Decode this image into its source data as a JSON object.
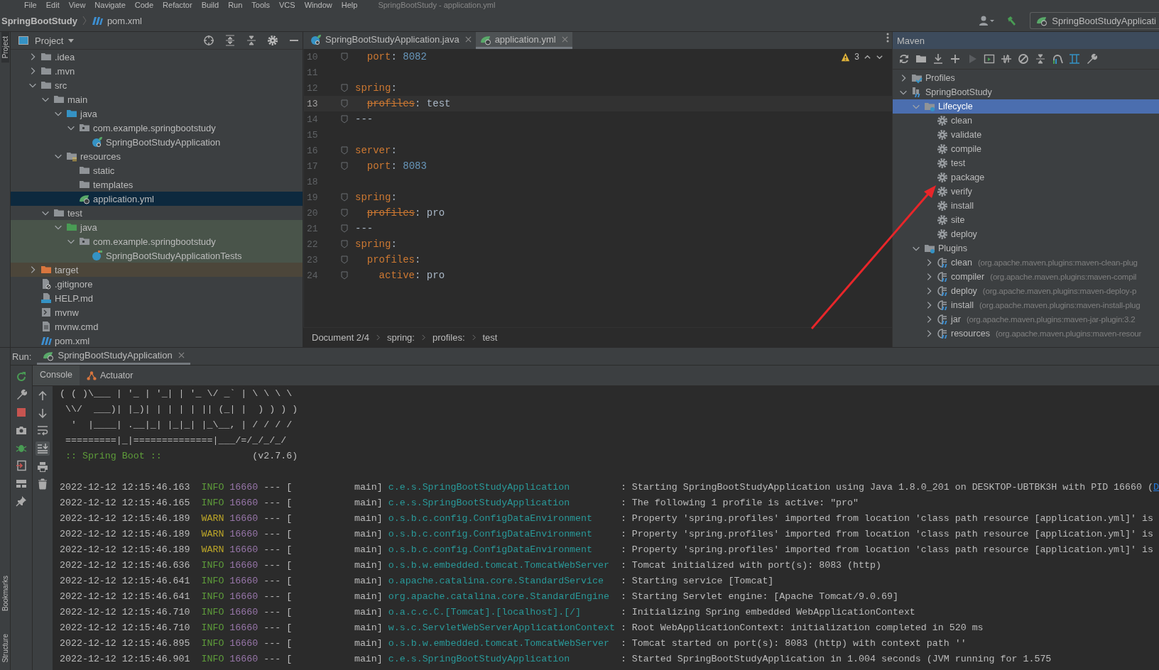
{
  "menu": [
    "File",
    "Edit",
    "View",
    "Navigate",
    "Code",
    "Refactor",
    "Build",
    "Run",
    "Tools",
    "VCS",
    "Window",
    "Help"
  ],
  "window_title": "SpringBootStudy - application.yml",
  "nav": {
    "project": "SpringBootStudy",
    "file": "pom.xml",
    "run_config": "SpringBootStudyApplicati"
  },
  "stripe": {
    "top": "Project",
    "bottom": [
      "Bookmarks",
      "Structure"
    ]
  },
  "project": {
    "title": "Project",
    "tree": [
      {
        "label": ".idea",
        "kind": "folder",
        "expanded": false,
        "selected": false
      },
      {
        "label": ".mvn",
        "kind": "folder",
        "expanded": false,
        "selected": false
      },
      {
        "label": "src",
        "kind": "folder",
        "expanded": true,
        "selected": false,
        "children": [
          {
            "label": "main",
            "kind": "folder",
            "expanded": true,
            "selected": false,
            "children": [
              {
                "label": "java",
                "kind": "source",
                "expanded": true,
                "selected": false,
                "children": [
                  {
                    "label": "com.example.springbootstudy",
                    "kind": "package",
                    "expanded": true,
                    "selected": false,
                    "children": [
                      {
                        "label": "SpringBootStudyApplication",
                        "kind": "class",
                        "selected": false
                      }
                    ]
                  }
                ]
              },
              {
                "label": "resources",
                "kind": "resources",
                "expanded": true,
                "selected": false,
                "children": [
                  {
                    "label": "static",
                    "kind": "folder",
                    "selected": false
                  },
                  {
                    "label": "templates",
                    "kind": "folder",
                    "selected": false
                  },
                  {
                    "label": "application.yml",
                    "kind": "config",
                    "selected": true
                  }
                ]
              }
            ]
          },
          {
            "label": "test",
            "kind": "folder",
            "expanded": true,
            "selected": false,
            "children": [
              {
                "label": "java",
                "kind": "testsource",
                "expanded": true,
                "selected": false,
                "children": [
                  {
                    "label": "com.example.springbootstudy",
                    "kind": "testpackage",
                    "expanded": true,
                    "selected": false,
                    "children": [
                      {
                        "label": "SpringBootStudyApplicationTests",
                        "kind": "testclass",
                        "selected": false
                      }
                    ]
                  }
                ]
              }
            ]
          }
        ]
      },
      {
        "label": "target",
        "kind": "output",
        "expanded": false,
        "selected": false
      },
      {
        "label": ".gitignore",
        "kind": "ignore",
        "selected": false
      },
      {
        "label": "HELP.md",
        "kind": "markdown",
        "selected": false
      },
      {
        "label": "mvnw",
        "kind": "script",
        "selected": false
      },
      {
        "label": "mvnw.cmd",
        "kind": "text",
        "selected": false
      },
      {
        "label": "pom.xml",
        "kind": "pom",
        "selected": false
      }
    ]
  },
  "editor": {
    "tabs": [
      {
        "label": "SpringBootStudyApplication.java",
        "kind": "class",
        "selected": false
      },
      {
        "label": "application.yml",
        "kind": "config",
        "selected": true
      }
    ],
    "warnings": "3",
    "lines": [
      {
        "num": "10",
        "current": false,
        "tokens": [
          {
            "text": "  port",
            "kind": "key"
          },
          {
            "text": ": ",
            "kind": "plain"
          },
          {
            "text": "8082",
            "kind": "number"
          }
        ]
      },
      {
        "num": "11",
        "current": false
      },
      {
        "num": "12",
        "current": false,
        "tokens": [
          {
            "text": "spring",
            "kind": "key"
          },
          {
            "text": ":",
            "kind": "plain"
          }
        ]
      },
      {
        "num": "13",
        "current": true,
        "tokens": [
          {
            "text": "  profiles",
            "kind": "deprecated"
          },
          {
            "text": ": test",
            "kind": "plain"
          }
        ]
      },
      {
        "num": "14",
        "current": false,
        "tokens": [
          {
            "text": "---",
            "kind": "plain"
          }
        ]
      },
      {
        "num": "15",
        "current": false
      },
      {
        "num": "16",
        "current": false,
        "tokens": [
          {
            "text": "server",
            "kind": "key"
          },
          {
            "text": ":",
            "kind": "plain"
          }
        ]
      },
      {
        "num": "17",
        "current": false,
        "tokens": [
          {
            "text": "  port",
            "kind": "key"
          },
          {
            "text": ": ",
            "kind": "plain"
          },
          {
            "text": "8083",
            "kind": "number"
          }
        ]
      },
      {
        "num": "18",
        "current": false
      },
      {
        "num": "19",
        "current": false,
        "tokens": [
          {
            "text": "spring",
            "kind": "key"
          },
          {
            "text": ":",
            "kind": "plain"
          }
        ]
      },
      {
        "num": "20",
        "current": false,
        "tokens": [
          {
            "text": "  profiles",
            "kind": "deprecated"
          },
          {
            "text": ": pro",
            "kind": "plain"
          }
        ]
      },
      {
        "num": "21",
        "current": false,
        "tokens": [
          {
            "text": "---",
            "kind": "plain"
          }
        ]
      },
      {
        "num": "22",
        "current": false,
        "tokens": [
          {
            "text": "spring",
            "kind": "key"
          },
          {
            "text": ":",
            "kind": "plain"
          }
        ]
      },
      {
        "num": "23",
        "current": false,
        "tokens": [
          {
            "text": "  profiles",
            "kind": "key"
          },
          {
            "text": ":",
            "kind": "plain"
          }
        ]
      },
      {
        "num": "24",
        "current": false,
        "tokens": [
          {
            "text": "    active",
            "kind": "key"
          },
          {
            "text": ": pro",
            "kind": "plain"
          }
        ]
      }
    ],
    "breadcrumb": [
      "Document 2/4",
      "spring:",
      "profiles:",
      "test"
    ]
  },
  "maven": {
    "title": "Maven",
    "tree": [
      {
        "label": "Profiles",
        "kind": "profiles",
        "expanded": false,
        "selected": false
      },
      {
        "label": "SpringBootStudy",
        "kind": "project",
        "expanded": true,
        "selected": false,
        "children": [
          {
            "label": "Lifecycle",
            "kind": "group",
            "expanded": true,
            "selected": true,
            "children": [
              {
                "label": "clean",
                "kind": "goal",
                "selected": false
              },
              {
                "label": "validate",
                "kind": "goal",
                "selected": false
              },
              {
                "label": "compile",
                "kind": "goal",
                "selected": false
              },
              {
                "label": "test",
                "kind": "goal",
                "selected": false
              },
              {
                "label": "package",
                "kind": "goal",
                "selected": false
              },
              {
                "label": "verify",
                "kind": "goal",
                "selected": false
              },
              {
                "label": "install",
                "kind": "goal",
                "selected": false
              },
              {
                "label": "site",
                "kind": "goal",
                "selected": false
              },
              {
                "label": "deploy",
                "kind": "goal",
                "selected": false
              }
            ]
          },
          {
            "label": "Plugins",
            "kind": "group",
            "expanded": true,
            "selected": false,
            "children": [
              {
                "label": "clean",
                "detail": "(org.apache.maven.plugins:maven-clean-plug",
                "kind": "plugin",
                "expanded": false,
                "selected": false
              },
              {
                "label": "compiler",
                "detail": "(org.apache.maven.plugins:maven-compil",
                "kind": "plugin",
                "expanded": false,
                "selected": false
              },
              {
                "label": "deploy",
                "detail": "(org.apache.maven.plugins:maven-deploy-p",
                "kind": "plugin",
                "expanded": false,
                "selected": false
              },
              {
                "label": "install",
                "detail": "(org.apache.maven.plugins:maven-install-plug",
                "kind": "plugin",
                "expanded": false,
                "selected": false
              },
              {
                "label": "jar",
                "detail": "(org.apache.maven.plugins:maven-jar-plugin:3.2",
                "kind": "plugin",
                "expanded": false,
                "selected": false
              },
              {
                "label": "resources",
                "detail": "(org.apache.maven.plugins:maven-resour",
                "kind": "plugin",
                "expanded": false,
                "selected": false
              }
            ]
          }
        ]
      }
    ]
  },
  "run": {
    "label": "Run:",
    "tab": "SpringBootStudyApplication",
    "console_tabs": [
      {
        "label": "Console",
        "selected": true
      },
      {
        "label": "Actuator",
        "selected": false
      }
    ],
    "banner": {
      "art": [
        "( ( )\\___ | '_ | '_| | '_ \\/ _` | \\ \\ \\ \\",
        " \\\\/  ___)| |_)| | | | | || (_| |  ) ) ) )",
        "  '  |____| .__|_| |_|_| |_\\__, | / / / /",
        " =========|_|==============|___/=/_/_/_/"
      ],
      "label": ":: Spring Boot ::",
      "version": "(v2.7.6)"
    },
    "log": [
      {
        "time": "2022-12-12 12:15:46.163",
        "level": "INFO",
        "kind": "info",
        "pid": "16660",
        "dashes": "---",
        "thread": "[           main]",
        "logger": "c.e.s.SpringBootStudyApplication",
        "message": ": Starting SpringBootStudyApplication using Java 1.8.0_201 on DESKTOP-UBTBK3H with PID 16660 (",
        "link": "D"
      },
      {
        "time": "2022-12-12 12:15:46.165",
        "level": "INFO",
        "kind": "info",
        "pid": "16660",
        "dashes": "---",
        "thread": "[           main]",
        "logger": "c.e.s.SpringBootStudyApplication",
        "message": ": The following 1 profile is active: \"pro\""
      },
      {
        "time": "2022-12-12 12:15:46.189",
        "level": "WARN",
        "kind": "warn",
        "pid": "16660",
        "dashes": "---",
        "thread": "[           main]",
        "logger": "o.s.b.c.config.ConfigDataEnvironment",
        "message": ": Property 'spring.profiles' imported from location 'class path resource [application.yml]' is"
      },
      {
        "time": "2022-12-12 12:15:46.189",
        "level": "WARN",
        "kind": "warn",
        "pid": "16660",
        "dashes": "---",
        "thread": "[           main]",
        "logger": "o.s.b.c.config.ConfigDataEnvironment",
        "message": ": Property 'spring.profiles' imported from location 'class path resource [application.yml]' is"
      },
      {
        "time": "2022-12-12 12:15:46.189",
        "level": "WARN",
        "kind": "warn",
        "pid": "16660",
        "dashes": "---",
        "thread": "[           main]",
        "logger": "o.s.b.c.config.ConfigDataEnvironment",
        "message": ": Property 'spring.profiles' imported from location 'class path resource [application.yml]' is"
      },
      {
        "time": "2022-12-12 12:15:46.636",
        "level": "INFO",
        "kind": "info",
        "pid": "16660",
        "dashes": "---",
        "thread": "[           main]",
        "logger": "o.s.b.w.embedded.tomcat.TomcatWebServer",
        "message": ": Tomcat initialized with port(s): 8083 (http)"
      },
      {
        "time": "2022-12-12 12:15:46.641",
        "level": "INFO",
        "kind": "info",
        "pid": "16660",
        "dashes": "---",
        "thread": "[           main]",
        "logger": "o.apache.catalina.core.StandardService",
        "message": ": Starting service [Tomcat]"
      },
      {
        "time": "2022-12-12 12:15:46.641",
        "level": "INFO",
        "kind": "info",
        "pid": "16660",
        "dashes": "---",
        "thread": "[           main]",
        "logger": "org.apache.catalina.core.StandardEngine",
        "message": ": Starting Servlet engine: [Apache Tomcat/9.0.69]"
      },
      {
        "time": "2022-12-12 12:15:46.710",
        "level": "INFO",
        "kind": "info",
        "pid": "16660",
        "dashes": "---",
        "thread": "[           main]",
        "logger": "o.a.c.c.C.[Tomcat].[localhost].[/]",
        "message": ": Initializing Spring embedded WebApplicationContext"
      },
      {
        "time": "2022-12-12 12:15:46.710",
        "level": "INFO",
        "kind": "info",
        "pid": "16660",
        "dashes": "---",
        "thread": "[           main]",
        "logger": "w.s.c.ServletWebServerApplicationContext",
        "message": ": Root WebApplicationContext: initialization completed in 520 ms"
      },
      {
        "time": "2022-12-12 12:15:46.895",
        "level": "INFO",
        "kind": "info",
        "pid": "16660",
        "dashes": "---",
        "thread": "[           main]",
        "logger": "o.s.b.w.embedded.tomcat.TomcatWebServer",
        "message": ": Tomcat started on port(s): 8083 (http) with context path ''"
      },
      {
        "time": "2022-12-12 12:15:46.901",
        "level": "INFO",
        "kind": "info",
        "pid": "16660",
        "dashes": "---",
        "thread": "[           main]",
        "logger": "c.e.s.SpringBootStudyApplication",
        "message": ": Started SpringBootStudyApplication in 1.004 seconds (JVM running for 1.575"
      }
    ]
  }
}
